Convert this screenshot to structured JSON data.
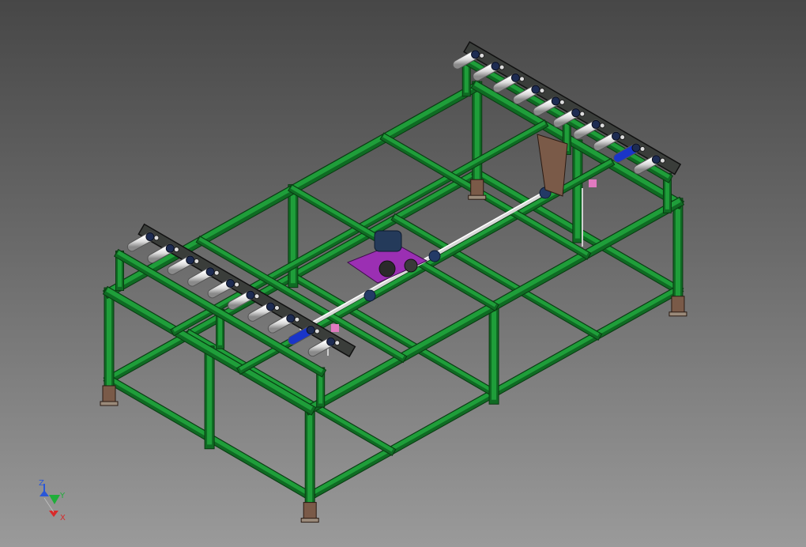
{
  "viewport": {
    "background_top": "#474747",
    "background_bottom": "#9a9a9a"
  },
  "model": {
    "frame_color": "#1f9e3a",
    "frame_shadow": "#0f6b23",
    "frame_edge": "#0a3a12",
    "conveyor_bar_color": "#3a3d3a",
    "roller_color": "#e8e8e8",
    "drive_plate_color": "#9b2fb3",
    "motor_color": "#243a5a",
    "bracket_color": "#7a5a48",
    "sensor_color": "#e07ac0",
    "accent_roller_color": "#1a35c8"
  },
  "triad": {
    "z_label": "Z",
    "y_label": "Y",
    "x_label": "X",
    "z_color": "#2a57d8",
    "y_color": "#1fae3a",
    "x_color": "#d82a2a"
  }
}
